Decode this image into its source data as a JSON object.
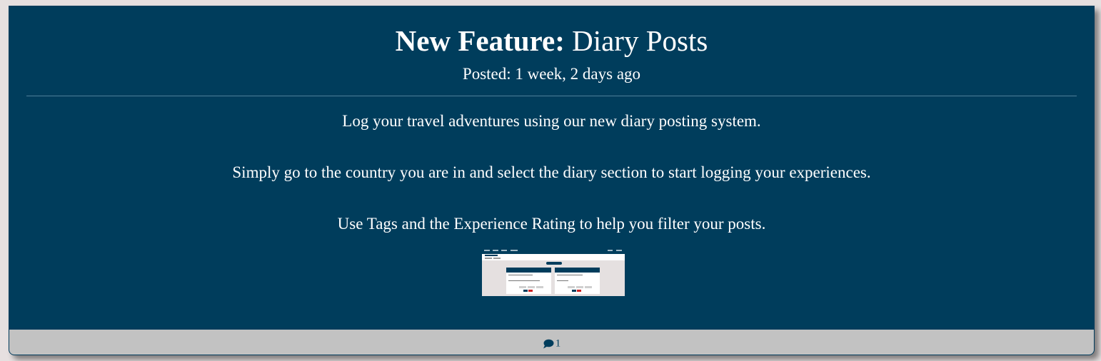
{
  "post": {
    "title_bold": "New Feature:",
    "title_rest": " Diary Posts",
    "posted": "Posted: 1 week, 2 days ago",
    "paragraphs": [
      "Log your travel adventures using our new diary posting system.",
      "Simply go to the country you are in and select the diary section to start logging your experiences.",
      "Use Tags and the Experience Rating to help you filter your posts."
    ],
    "thumbnail": {
      "card1_date": "07th Mar 2025",
      "card2_date": "07th Mar 2025"
    }
  },
  "footer": {
    "comment_icon": "comment-icon",
    "comment_count": "1"
  },
  "colors": {
    "card_bg": "#003d5c",
    "footer_bg": "#c2c2c2",
    "page_bg": "#e6e0e0",
    "text": "#ffffff"
  }
}
